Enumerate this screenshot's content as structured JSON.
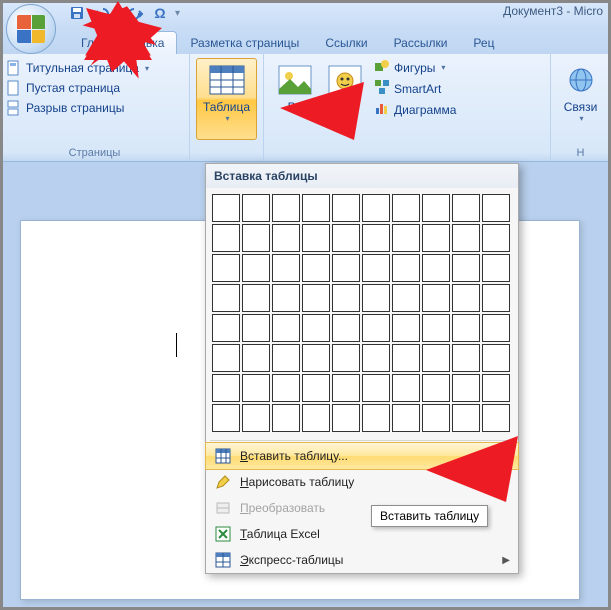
{
  "title": "Документ3 - Micro",
  "tabs": {
    "home": "Гл",
    "insert": "Вставка",
    "layout": "Разметка страницы",
    "refs": "Ссылки",
    "mail": "Рассылки",
    "review": "Рец"
  },
  "pages_group": {
    "label": "Страницы",
    "title_page": "Титульная страница",
    "blank_page": "Пустая страница",
    "page_break": "Разрыв страницы"
  },
  "table_group": {
    "label": "Таблица",
    "dropdown_title": "Вставка таблицы",
    "insert_table": "Вставить таблицу...",
    "draw_table": "Нарисовать таблицу",
    "convert": "Преобразовать",
    "excel": "Таблица Excel",
    "quick": "Экспресс-таблицы",
    "tooltip": "Вставить таблицу",
    "grid_rows": 8,
    "grid_cols": 10
  },
  "illustrations": {
    "picture": "Ри",
    "clip": "Клип",
    "shapes": "Фигуры",
    "smartart": "SmartArt",
    "chart": "Диаграмма"
  },
  "links_group": {
    "label": "Связи",
    "next": "Н"
  },
  "colors": {
    "accent": "#ffcd54",
    "ribbon": "#d7e7f9"
  }
}
